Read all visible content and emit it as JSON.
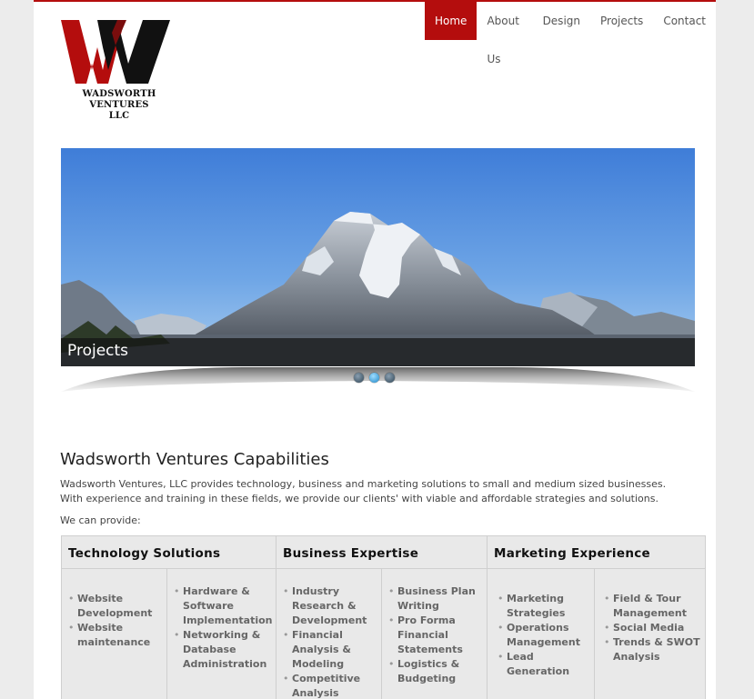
{
  "brand": {
    "logo_letter": "W",
    "logo_text_line1": "WADSWORTH",
    "logo_text_line2": "VENTURES",
    "logo_text_line3": "LLC"
  },
  "nav": {
    "items": [
      {
        "label": "Home",
        "active": true
      },
      {
        "label": "About Us",
        "active": false
      },
      {
        "label": "Design",
        "active": false
      },
      {
        "label": "Projects",
        "active": false
      },
      {
        "label": "Contact",
        "active": false
      }
    ]
  },
  "slider": {
    "caption": "Projects",
    "slide_count": 3,
    "active_index": 1
  },
  "content": {
    "heading": "Wadsworth Ventures Capabilities",
    "intro": "Wadsworth Ventures, LLC provides technology, business and marketing solutions to small and medium sized businesses. With experience and training in these fields, we provide our clients' with viable and affordable strategies and solutions.",
    "provide": "We can provide:"
  },
  "capabilities": [
    {
      "title": "Technology Solutions",
      "left": [
        "Website Development",
        "Website maintenance"
      ],
      "right": [
        "Hardware & Software Implementation",
        "Networking & Database Administration"
      ]
    },
    {
      "title": "Business Expertise",
      "left": [
        "Industry Research & Development",
        "Financial Analysis & Modeling",
        "Competitive Analysis"
      ],
      "right": [
        "Business Plan Writing",
        "Pro Forma Financial Statements",
        "Logistics & Budgeting"
      ]
    },
    {
      "title": "Marketing Experience",
      "left": [
        "Marketing Strategies",
        "Operations Management",
        "Lead Generation"
      ],
      "right": [
        "Field & Tour Management",
        "Social Media",
        "Trends & SWOT Analysis"
      ]
    }
  ],
  "colors": {
    "accent": "#b40d0d",
    "logo_black": "#111111"
  }
}
